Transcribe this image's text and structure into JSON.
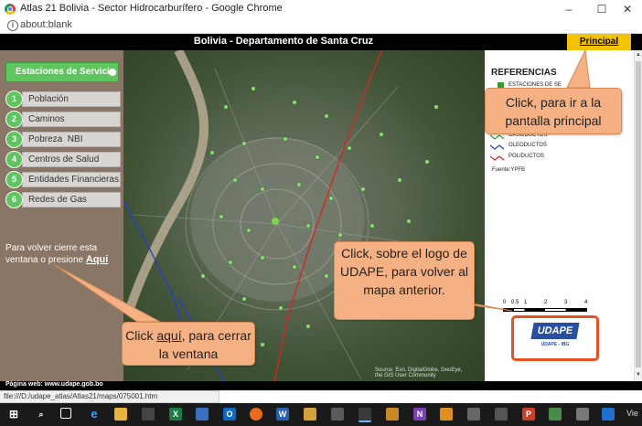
{
  "window": {
    "title": "Atlas 21 Bolivia - Sector Hidrocarburífero - Google Chrome",
    "address": "about:blank",
    "minimize": "–",
    "maximize": "☐",
    "close": "✕"
  },
  "header": {
    "title": "Bolivia - Departamento de Santa Cruz",
    "principal_link": "Principal"
  },
  "sidebar": {
    "active_item": "Estaciones de Servicio",
    "items": [
      {
        "num": "1",
        "label": "Población"
      },
      {
        "num": "2",
        "label": "Caminos"
      },
      {
        "num": "3",
        "label": "Pobreza  NBI"
      },
      {
        "num": "4",
        "label": "Centros de Salud"
      },
      {
        "num": "5",
        "label": "Entidades Financieras"
      },
      {
        "num": "6",
        "label": "Redes de Gas"
      }
    ],
    "close_text": "Para volver cierre esta ventana o presione",
    "close_link": "Aqui"
  },
  "legend": {
    "title": "REFERENCIAS",
    "items": [
      {
        "label": "ESTACIONES DE SE",
        "color": "#2e9e2e"
      },
      {
        "label": "GASODUCTOS",
        "color": "#2e9e2e"
      },
      {
        "label": "OLEODUCTOS",
        "color": "#1f3fd0"
      },
      {
        "label": "POLIDUCTOS",
        "color": "#e02020"
      }
    ],
    "source": "Fuente:YPFB",
    "scale_labels": [
      "0",
      "0.5",
      "1",
      "2",
      "3",
      "4"
    ]
  },
  "udape": {
    "logo": "UDAPE",
    "subtitle": "UDAPE - IBG"
  },
  "map": {
    "attribution_1": "Source: Esri, DigitalGlobe, GeoEye,",
    "attribution_2": "the GIS User Community"
  },
  "callouts": {
    "principal": "Click, para ir a la pantalla principal",
    "udape": "Click, sobre el logo de UDAPE, para volver al mapa anterior.",
    "close_pre": "Click ",
    "close_link": "aquí",
    "close_post": ", para cerrar la ventana"
  },
  "footer": {
    "text": "Página web: www.udape.gob.bo",
    "status_url": "file:///D:/udape_atlas/Atlas21/maps/075001.htm"
  },
  "taskbar": {
    "time": "Vie"
  },
  "colors": {
    "header_bg": "#000000",
    "principal_bg": "#f3c200",
    "sidebar_bg": "#8a7666",
    "menu_accent": "#5fc65f",
    "callout_bg": "#f5b183",
    "udape_border": "#e8501f"
  }
}
